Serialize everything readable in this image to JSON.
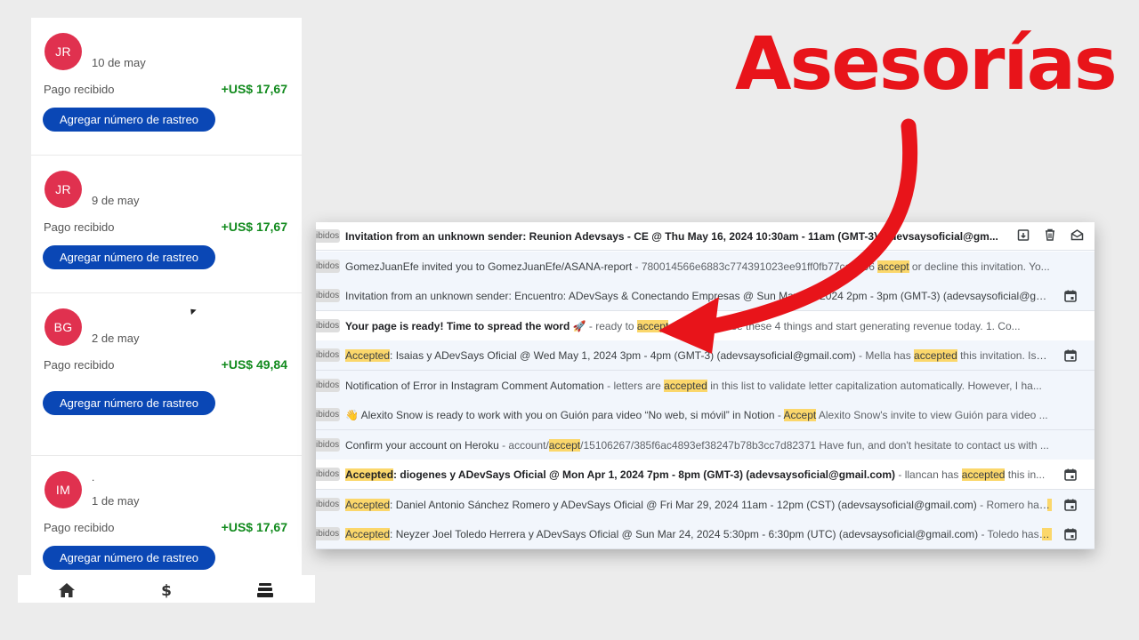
{
  "orders": [
    {
      "initials": "JR",
      "avatar_color": "#e0314f",
      "name": "",
      "date": "10 de may",
      "status": "Pago recibido",
      "amount": "+US$ 17,67",
      "action": "Agregar número de rastreo"
    },
    {
      "initials": "JR",
      "avatar_color": "#e0314f",
      "name": "",
      "date": "9 de may",
      "status": "Pago recibido",
      "amount": "+US$ 17,67",
      "action": "Agregar número de rastreo"
    },
    {
      "initials": "BG",
      "avatar_color": "#e0314f",
      "name": "",
      "date": "2 de may",
      "status": "Pago recibido",
      "amount": "+US$ 49,84",
      "action": "Agregar número de rastreo"
    },
    {
      "initials": "IM",
      "avatar_color": "#e0314f",
      "name": ".",
      "date": "1 de may",
      "status": "Pago recibido",
      "amount": "+US$ 17,67",
      "action": "Agregar número de rastreo"
    }
  ],
  "bottom_nav": [
    {
      "name": "home",
      "icon": "home-icon"
    },
    {
      "name": "payments",
      "icon": "dollar-icon"
    },
    {
      "name": "inventory",
      "icon": "stack-icon"
    }
  ],
  "inbox": {
    "label": "Recibidos",
    "label_visible": "ibidos",
    "emails": [
      {
        "parts": [
          {
            "t": "Invitation from an unknown sender: Reunion Adevsays - CE @ Thu May 16, 2024 10:30am - 11am (GMT-3) (adevsaysoficial@gm...",
            "c": "bold"
          }
        ],
        "read": false,
        "icon": "actions"
      },
      {
        "parts": [
          {
            "t": "GomezJuanEfe invited you to GomezJuanEfe/ASANA-report",
            "c": ""
          },
          {
            "t": " - 780014566e6883c774391023ee91ff0fb77ce9866 ",
            "c": "snip"
          },
          {
            "t": "accept",
            "c": "hl"
          },
          {
            "t": " or decline this invitation. Yo...",
            "c": "snip"
          }
        ],
        "read": true,
        "icon": ""
      },
      {
        "parts": [
          {
            "t": "Invitation from an unknown sender: Encuentro: ADevSays & Conectando Empresas @ Sun May 12, 2024 2pm - 3pm (GMT-3) (adevsaysoficial@gmai...",
            "c": ""
          }
        ],
        "read": true,
        "icon": "calendar-icon"
      },
      {
        "parts": [
          {
            "t": "Your page is ready! Time to spread the word 🚀",
            "c": "bold"
          },
          {
            "t": " - ready to ",
            "c": "snip"
          },
          {
            "t": "accept",
            "c": "hl"
          },
          {
            "t": " payments. Use these 4 things and start generating revenue today. 1. Co...",
            "c": "snip"
          }
        ],
        "read": false,
        "icon": ""
      },
      {
        "parts": [
          {
            "t": "Accepted",
            "c": "hl"
          },
          {
            "t": ": Isaias y ADevSays Oficial @ Wed May 1, 2024 3pm - 4pm (GMT-3) (adevsaysoficial@gmail.com)",
            "c": ""
          },
          {
            "t": " - Mella has ",
            "c": "snip"
          },
          {
            "t": "accepted",
            "c": "hl"
          },
          {
            "t": " this invitation. Isaia...",
            "c": "snip"
          }
        ],
        "read": true,
        "icon": "calendar-icon"
      },
      {
        "parts": [
          {
            "t": "Notification of Error in Instagram Comment Automation",
            "c": ""
          },
          {
            "t": " - letters are ",
            "c": "snip"
          },
          {
            "t": "accepted",
            "c": "hl"
          },
          {
            "t": " in this list to validate letter capitalization automatically. However, I ha...",
            "c": "snip"
          }
        ],
        "read": true,
        "icon": ""
      },
      {
        "parts": [
          {
            "t": "👋 Alexito Snow is ready to work with you on Guión para video “No web, si móvil” in Notion",
            "c": ""
          },
          {
            "t": " - ",
            "c": "snip"
          },
          {
            "t": "Accept",
            "c": "hl"
          },
          {
            "t": " Alexito Snow's invite to view Guión para video ...",
            "c": "snip"
          }
        ],
        "read": true,
        "icon": ""
      },
      {
        "parts": [
          {
            "t": "Confirm your account on Heroku",
            "c": ""
          },
          {
            "t": " - account/",
            "c": "snip"
          },
          {
            "t": "accept",
            "c": "hl"
          },
          {
            "t": "/15106267/385f6ac4893ef38247b78b3cc7d82371 Have fun, and don't hesitate to contact us with ...",
            "c": "snip"
          }
        ],
        "read": true,
        "icon": ""
      },
      {
        "parts": [
          {
            "t": "Accepted",
            "c": "hl bold"
          },
          {
            "t": ": diogenes y ADevSays Oficial @ Mon Apr 1, 2024 7pm - 8pm (GMT-3) (adevsaysoficial@gmail.com)",
            "c": "bold"
          },
          {
            "t": " - llancan has ",
            "c": "snip"
          },
          {
            "t": "accepted",
            "c": "hl"
          },
          {
            "t": " this in...",
            "c": "snip"
          }
        ],
        "read": false,
        "icon": "calendar-icon"
      },
      {
        "parts": [
          {
            "t": "Accepted",
            "c": "hl"
          },
          {
            "t": ": Daniel Antonio Sánchez Romero y ADevSays Oficial @ Fri Mar 29, 2024 11am - 12pm (CST) (adevsaysoficial@gmail.com)",
            "c": ""
          },
          {
            "t": " - Romero has ",
            "c": "snip"
          },
          {
            "t": "ac...",
            "c": "hl"
          }
        ],
        "read": true,
        "icon": "calendar-icon"
      },
      {
        "parts": [
          {
            "t": "Accepted",
            "c": "hl"
          },
          {
            "t": ": Neyzer Joel Toledo Herrera y ADevSays Oficial @ Sun Mar 24, 2024 5:30pm - 6:30pm (UTC) (adevsaysoficial@gmail.com)",
            "c": ""
          },
          {
            "t": " - Toledo has ",
            "c": "snip"
          },
          {
            "t": "a...",
            "c": "hl"
          }
        ],
        "read": true,
        "icon": "calendar-icon"
      }
    ]
  },
  "headline": "Asesorías",
  "colors": {
    "accent_red": "#e8141a",
    "button_blue": "#0a47b5",
    "amount_green": "#118a1d",
    "highlight": "#fbd76b"
  }
}
